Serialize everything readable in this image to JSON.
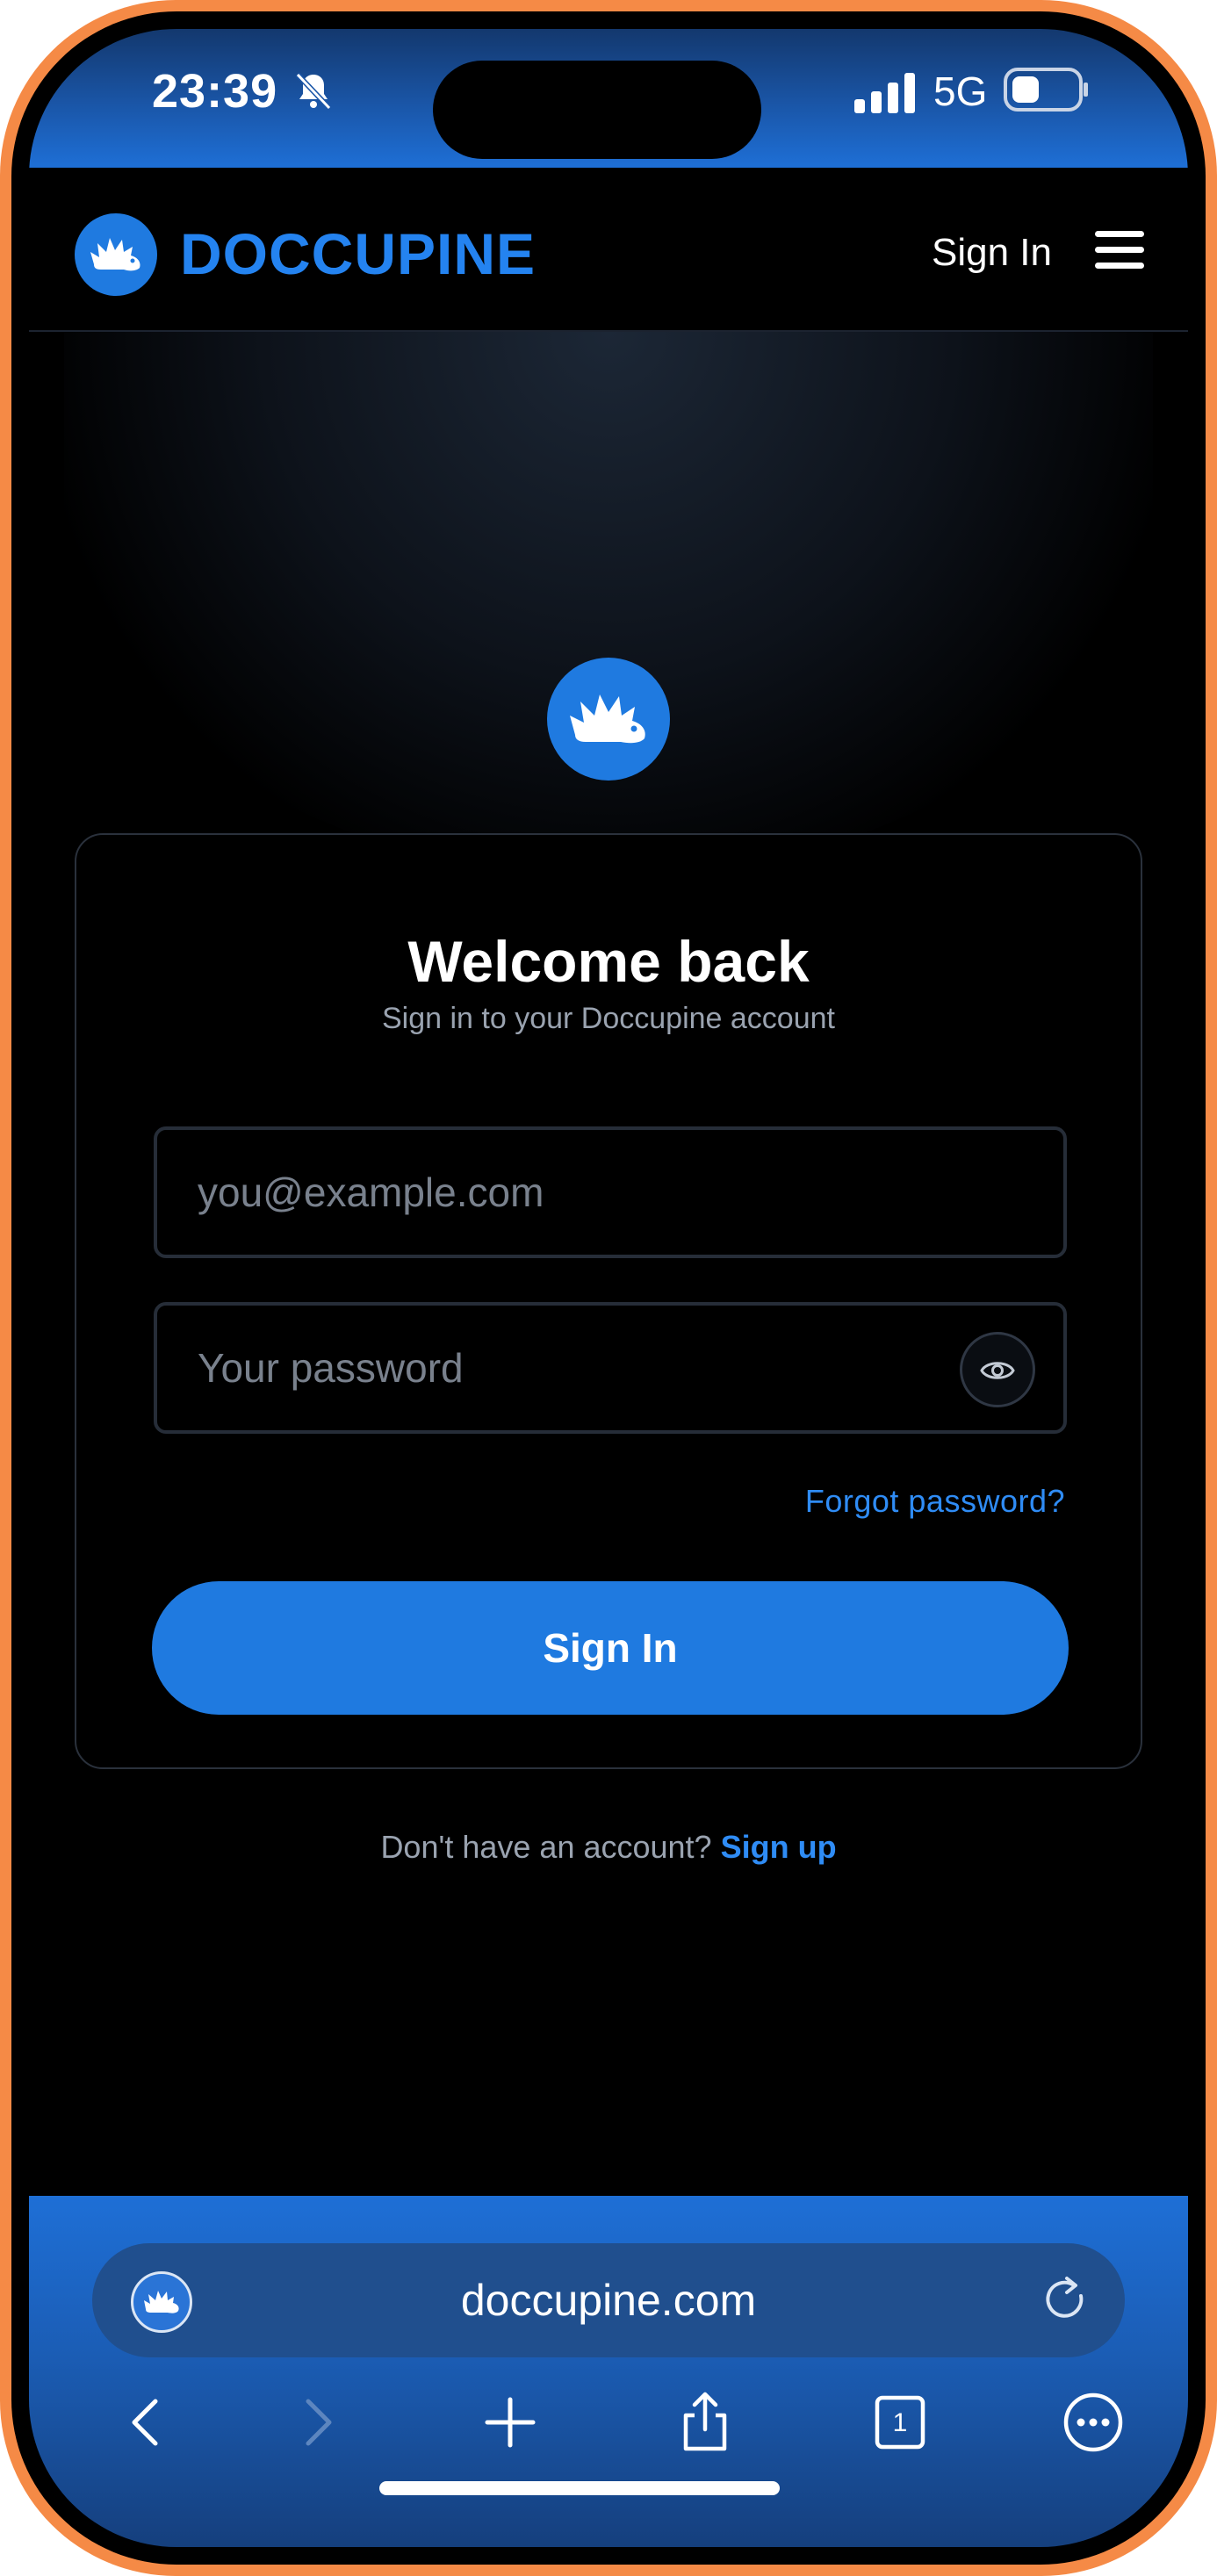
{
  "status_bar": {
    "time": "23:39",
    "network": "5G",
    "icons": [
      "bell-muted-icon",
      "signal-icon",
      "battery-icon"
    ]
  },
  "header": {
    "brand": "DOCCUPINE",
    "sign_in": "Sign In",
    "menu_icon": "hamburger-icon"
  },
  "login": {
    "title": "Welcome back",
    "subtitle": "Sign in to your Doccupine account",
    "email_placeholder": "you@example.com",
    "password_placeholder": "Your password",
    "forgot": "Forgot password?",
    "submit": "Sign In",
    "no_account": "Don't have an account?",
    "signup": "Sign up"
  },
  "browser": {
    "url": "doccupine.com",
    "tab_count": "1",
    "toolbar_icons": [
      "back-icon",
      "forward-icon",
      "new-tab-icon",
      "share-icon",
      "tabs-icon",
      "more-icon"
    ]
  },
  "colors": {
    "accent": "#1f7ae0",
    "link": "#2f8cf5",
    "frame": "#f58a46"
  }
}
